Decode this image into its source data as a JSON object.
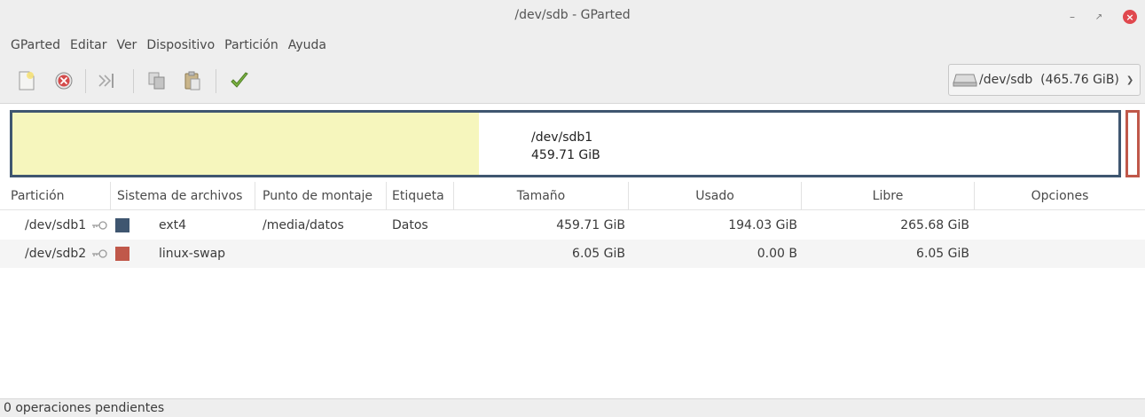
{
  "window": {
    "title": "/dev/sdb - GParted",
    "controls": {
      "minimize": "minimize-icon",
      "maximize": "maximize-icon",
      "close": "close-icon"
    }
  },
  "menubar": {
    "items": [
      "GParted",
      "Editar",
      "Ver",
      "Dispositivo",
      "Partición",
      "Ayuda"
    ]
  },
  "toolbar": {
    "buttons": [
      "new-partition-icon",
      "delete-partition-icon",
      "resize-move-icon",
      "copy-icon",
      "paste-icon",
      "apply-icon"
    ]
  },
  "device_selector": {
    "label": "/dev/sdb  (465.76 GiB)",
    "icon": "hard-disk-icon"
  },
  "disk_map": {
    "partition1": {
      "name": "/dev/sdb1",
      "size": "459.71 GiB",
      "used_fraction": 0.422,
      "border_color": "#3f5670",
      "used_color": "#f6f6bd"
    },
    "partition2": {
      "border_color": "#c0584a"
    }
  },
  "table": {
    "headers": [
      "Partición",
      "Sistema de archivos",
      "Punto de montaje",
      "Etiqueta",
      "Tamaño",
      "Usado",
      "Libre",
      "Opciones"
    ],
    "rows": [
      {
        "partition": "/dev/sdb1",
        "fs": "ext4",
        "fs_color": "#3f5670",
        "mount": "/media/datos",
        "label": "Datos",
        "size": "459.71 GiB",
        "used": "194.03 GiB",
        "free": "265.68 GiB"
      },
      {
        "partition": "/dev/sdb2",
        "fs": "linux-swap",
        "fs_color": "#c0584a",
        "mount": "",
        "label": "",
        "size": "6.05 GiB",
        "used": "0.00 B",
        "free": "6.05 GiB"
      }
    ]
  },
  "status": {
    "text": "0 operaciones pendientes"
  }
}
